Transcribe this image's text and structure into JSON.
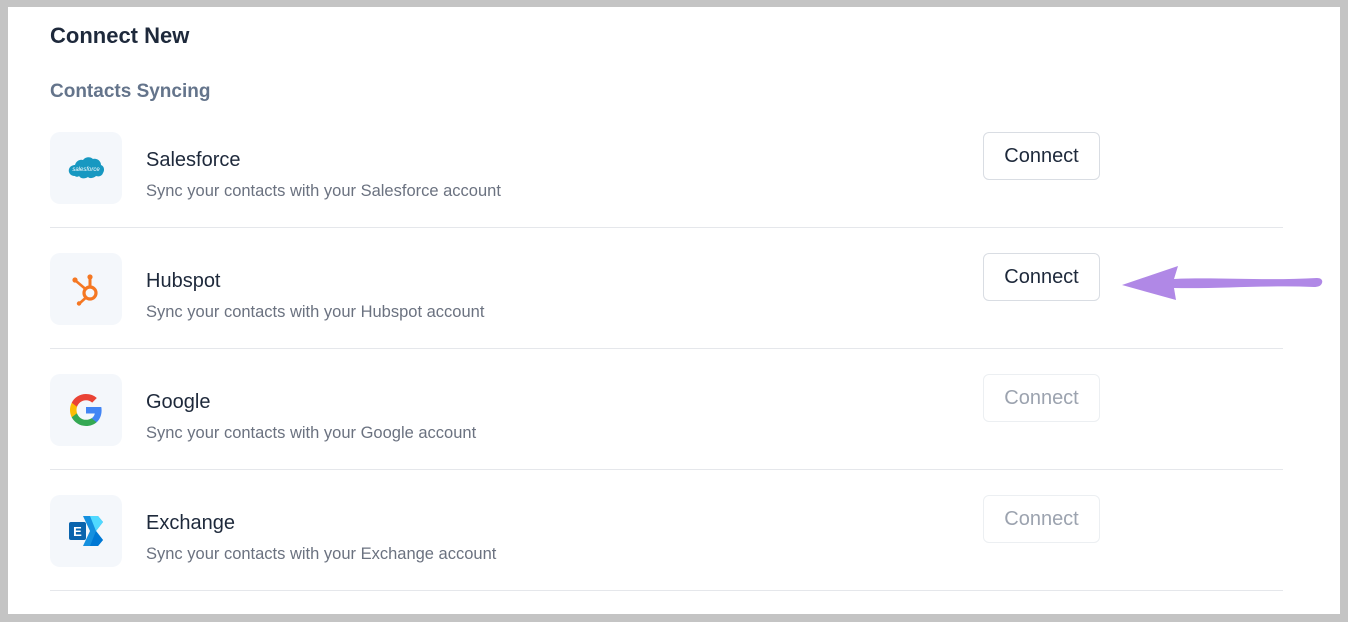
{
  "page": {
    "title": "Connect New",
    "section_title": "Contacts Syncing"
  },
  "integrations": [
    {
      "name": "Salesforce",
      "description": "Sync your contacts with your Salesforce account",
      "icon": "salesforce-logo-icon",
      "button_label": "Connect",
      "enabled": true
    },
    {
      "name": "Hubspot",
      "description": "Sync your contacts with your Hubspot account",
      "icon": "hubspot-logo-icon",
      "button_label": "Connect",
      "enabled": true
    },
    {
      "name": "Google",
      "description": "Sync your contacts with your Google account",
      "icon": "google-logo-icon",
      "button_label": "Connect",
      "enabled": false
    },
    {
      "name": "Exchange",
      "description": "Sync your contacts with your Exchange account",
      "icon": "exchange-logo-icon",
      "button_label": "Connect",
      "enabled": false
    }
  ],
  "logo_text": {
    "salesforce": "salesforce",
    "exchange": "E"
  },
  "annotation": {
    "icon": "arrow-left-icon",
    "color": "#b088e6"
  },
  "colors": {
    "heading": "#1e293b",
    "section": "#64748b",
    "description": "#6b7280",
    "disabled": "#9ca3af"
  }
}
